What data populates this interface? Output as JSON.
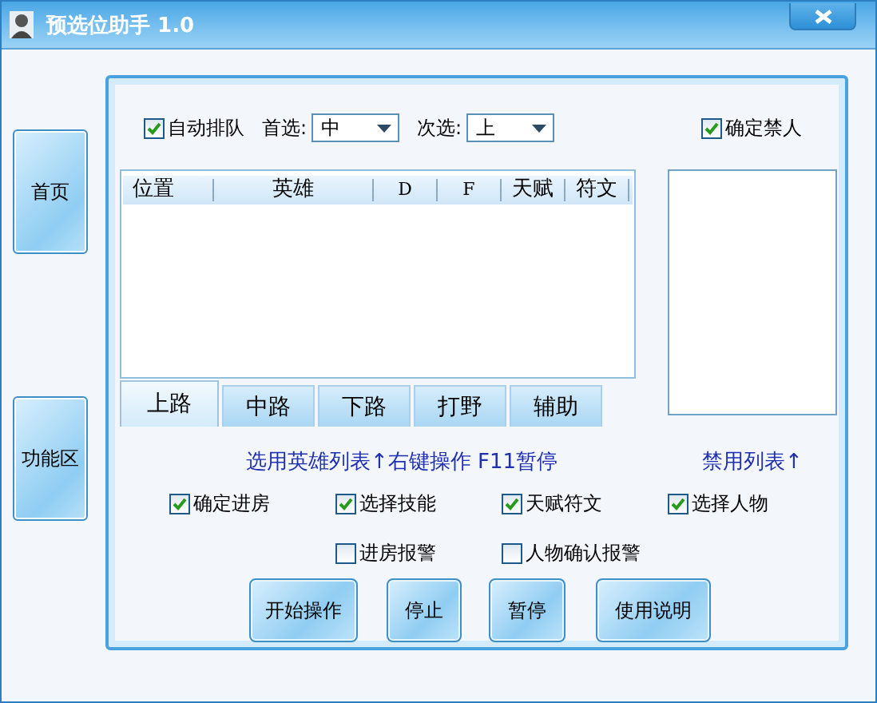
{
  "window": {
    "title": "预选位助手 1.0"
  },
  "sidebar": {
    "items": [
      {
        "label": "首页"
      },
      {
        "label": "功能区"
      }
    ]
  },
  "options": {
    "auto_queue": {
      "label": "自动排队",
      "checked": true
    },
    "first_choice": {
      "label": "首选:",
      "value": "中"
    },
    "second_choice": {
      "label": "次选:",
      "value": "上"
    },
    "confirm_ban": {
      "label": "确定禁人",
      "checked": true
    }
  },
  "table": {
    "columns": [
      "位置",
      "英雄",
      "D",
      "F",
      "天赋",
      "符文"
    ]
  },
  "tabs": [
    {
      "label": "上路",
      "selected": true
    },
    {
      "label": "中路",
      "selected": false
    },
    {
      "label": "下路",
      "selected": false
    },
    {
      "label": "打野",
      "selected": false
    },
    {
      "label": "辅助",
      "selected": false
    }
  ],
  "hints": {
    "pick_list": "选用英雄列表↑右键操作 F11暂停",
    "ban_list": "禁用列表↑"
  },
  "checkboxes": [
    {
      "label": "确定进房",
      "checked": true
    },
    {
      "label": "选择技能",
      "checked": true
    },
    {
      "label": "天赋符文",
      "checked": true
    },
    {
      "label": "选择人物",
      "checked": true
    },
    {
      "label": "进房报警",
      "checked": false
    },
    {
      "label": "人物确认报警",
      "checked": false
    }
  ],
  "buttons": [
    "开始操作",
    "停止",
    "暂停",
    "使用说明"
  ]
}
